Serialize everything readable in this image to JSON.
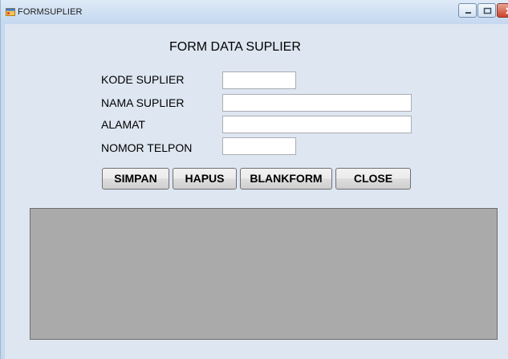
{
  "window": {
    "title": "FORMSUPLIER",
    "icon": "form-window-icon"
  },
  "form": {
    "heading": "FORM DATA SUPLIER"
  },
  "fields": [
    {
      "label": "KODE SUPLIER",
      "value": "",
      "placeholder": ""
    },
    {
      "label": "NAMA SUPLIER",
      "value": "",
      "placeholder": ""
    },
    {
      "label": "ALAMAT",
      "value": "",
      "placeholder": ""
    },
    {
      "label": "NOMOR TELPON",
      "value": "",
      "placeholder": ""
    }
  ],
  "buttons": {
    "simpan": "SIMPAN",
    "hapus": "HAPUS",
    "blankform": "BLANKFORM",
    "close": "CLOSE"
  },
  "colors": {
    "client_background": "#dde6f1",
    "grid_background": "#aaaaaa",
    "titlebar": "#cfe0f3"
  }
}
